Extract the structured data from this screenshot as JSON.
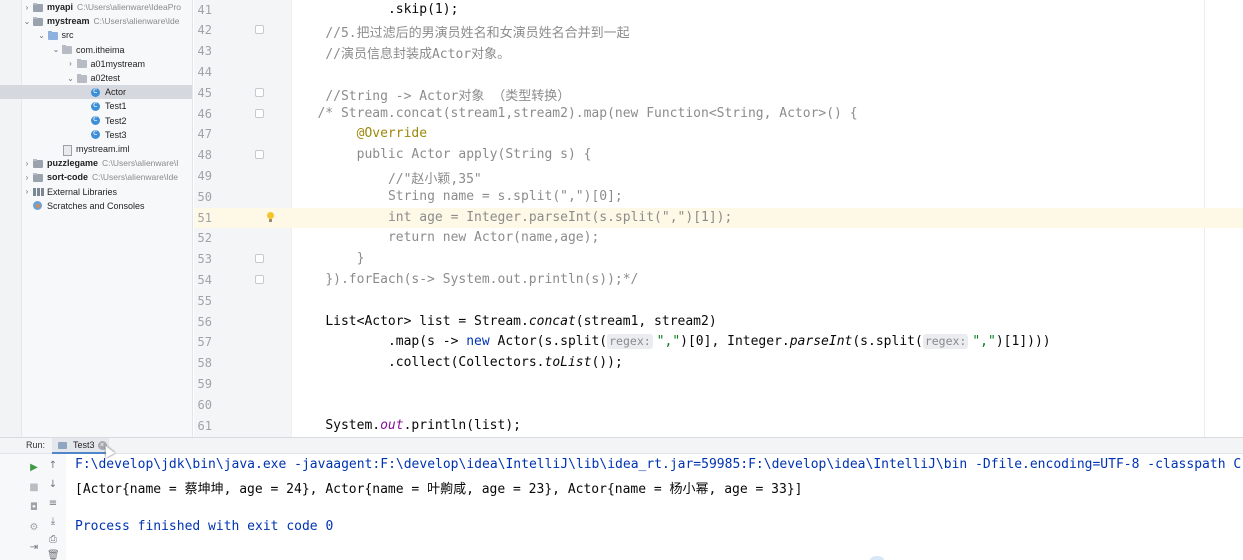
{
  "project_tree": {
    "items": [
      {
        "name": "myapi",
        "path": "C:\\Users\\alienware\\IdeaPro",
        "depth": 0,
        "arrow": "›",
        "icon": "module-folder-icon",
        "bold": true
      },
      {
        "name": "mystream",
        "path": "C:\\Users\\alienware\\Ide",
        "depth": 0,
        "arrow": "⌄",
        "icon": "module-folder-icon",
        "bold": true
      },
      {
        "name": "src",
        "path": "",
        "depth": 1,
        "arrow": "⌄",
        "icon": "source-folder-icon",
        "bold": false
      },
      {
        "name": "com.itheima",
        "path": "",
        "depth": 2,
        "arrow": "⌄",
        "icon": "package-icon",
        "bold": false
      },
      {
        "name": "a01mystream",
        "path": "",
        "depth": 3,
        "arrow": "›",
        "icon": "package-icon",
        "bold": false
      },
      {
        "name": "a02test",
        "path": "",
        "depth": 3,
        "arrow": "⌄",
        "icon": "package-icon",
        "bold": false
      },
      {
        "name": "Actor",
        "path": "",
        "depth": 4,
        "arrow": "",
        "icon": "java-class-icon",
        "bold": false,
        "selected": true
      },
      {
        "name": "Test1",
        "path": "",
        "depth": 4,
        "arrow": "",
        "icon": "java-class-icon",
        "bold": false
      },
      {
        "name": "Test2",
        "path": "",
        "depth": 4,
        "arrow": "",
        "icon": "java-class-icon",
        "bold": false
      },
      {
        "name": "Test3",
        "path": "",
        "depth": 4,
        "arrow": "",
        "icon": "java-class-icon",
        "bold": false
      },
      {
        "name": "mystream.iml",
        "path": "",
        "depth": 2,
        "arrow": "",
        "icon": "iml-file-icon",
        "bold": false
      },
      {
        "name": "puzzlegame",
        "path": "C:\\Users\\alienware\\I",
        "depth": 0,
        "arrow": "›",
        "icon": "module-folder-icon",
        "bold": true
      },
      {
        "name": "sort-code",
        "path": "C:\\Users\\alienware\\Ide",
        "depth": 0,
        "arrow": "›",
        "icon": "module-folder-icon",
        "bold": true
      },
      {
        "name": "External Libraries",
        "path": "",
        "depth": 0,
        "arrow": "›",
        "icon": "libraries-icon",
        "bold": false
      },
      {
        "name": "Scratches and Consoles",
        "path": "",
        "depth": 0,
        "arrow": "",
        "icon": "scratches-icon",
        "bold": false
      }
    ]
  },
  "editor": {
    "caret_line": 51,
    "lines": [
      {
        "num": "41",
        "indent": 12,
        "fold": false,
        "bulb": false,
        "tokens": [
          {
            "t": ".skip(1);",
            "c": ""
          }
        ]
      },
      {
        "num": "42",
        "indent": 4,
        "fold": true,
        "bulb": false,
        "tokens": [
          {
            "t": "//5.把过滤后的男演员姓名和女演员姓名合并到一起",
            "c": "cmt"
          }
        ]
      },
      {
        "num": "43",
        "indent": 4,
        "fold": false,
        "bulb": false,
        "tokens": [
          {
            "t": "//演员信息封装成Actor对象。",
            "c": "cmt"
          }
        ]
      },
      {
        "num": "44",
        "indent": 0,
        "fold": false,
        "bulb": false,
        "tokens": []
      },
      {
        "num": "45",
        "indent": 4,
        "fold": true,
        "bulb": false,
        "tokens": [
          {
            "t": "//String -> Actor对象 （类型转换）",
            "c": "cmt"
          }
        ]
      },
      {
        "num": "46",
        "indent": 3,
        "fold": true,
        "bulb": false,
        "tokens": [
          {
            "t": "/* Stream.concat(stream1,stream2).map(new Function<String, Actor>() {",
            "c": "cmt"
          }
        ]
      },
      {
        "num": "47",
        "indent": 8,
        "fold": false,
        "bulb": false,
        "tokens": [
          {
            "t": "@Override",
            "c": "ann"
          }
        ]
      },
      {
        "num": "48",
        "indent": 8,
        "fold": true,
        "bulb": false,
        "tokens": [
          {
            "t": "public Actor apply(String s) {",
            "c": "cmt"
          }
        ]
      },
      {
        "num": "49",
        "indent": 12,
        "fold": false,
        "bulb": false,
        "tokens": [
          {
            "t": "//\"赵小颖,35\"",
            "c": "cmt"
          }
        ]
      },
      {
        "num": "50",
        "indent": 12,
        "fold": false,
        "bulb": false,
        "tokens": [
          {
            "t": "String name = s.split(\",\")[0];",
            "c": "cmt"
          }
        ]
      },
      {
        "num": "51",
        "indent": 12,
        "fold": false,
        "bulb": true,
        "tokens": [
          {
            "t": "int age = Integer.parseInt(s.split(\",\")[1]);",
            "c": "cmt"
          }
        ]
      },
      {
        "num": "52",
        "indent": 12,
        "fold": false,
        "bulb": false,
        "tokens": [
          {
            "t": "return new Actor(name,age);",
            "c": "cmt"
          }
        ]
      },
      {
        "num": "53",
        "indent": 8,
        "fold": true,
        "bulb": false,
        "tokens": [
          {
            "t": "}",
            "c": "cmt"
          }
        ]
      },
      {
        "num": "54",
        "indent": 4,
        "fold": true,
        "bulb": false,
        "tokens": [
          {
            "t": "}).forEach(s-> System.out.println(s));*/",
            "c": "cmt"
          }
        ]
      },
      {
        "num": "55",
        "indent": 0,
        "fold": false,
        "bulb": false,
        "tokens": []
      },
      {
        "num": "56",
        "indent": 4,
        "fold": false,
        "bulb": false,
        "tokens": [
          {
            "t": "List<Actor> list = Stream.",
            "c": ""
          },
          {
            "t": "concat",
            "c": "ital"
          },
          {
            "t": "(stream1, stream2)",
            "c": ""
          }
        ]
      },
      {
        "num": "57",
        "indent": 12,
        "fold": false,
        "bulb": false,
        "tokens": [
          {
            "t": ".map(s -> ",
            "c": ""
          },
          {
            "t": "new",
            "c": "kw"
          },
          {
            "t": " Actor(s.split(",
            "c": ""
          },
          {
            "t": "regex:",
            "c": "hint"
          },
          {
            "t": "\",\"",
            "c": "str"
          },
          {
            "t": ")[0], Integer.",
            "c": ""
          },
          {
            "t": "parseInt",
            "c": "ital"
          },
          {
            "t": "(s.split(",
            "c": ""
          },
          {
            "t": "regex:",
            "c": "hint"
          },
          {
            "t": "\",\"",
            "c": "str"
          },
          {
            "t": ")[1])))",
            "c": ""
          }
        ]
      },
      {
        "num": "58",
        "indent": 12,
        "fold": false,
        "bulb": false,
        "tokens": [
          {
            "t": ".collect(Collectors.",
            "c": ""
          },
          {
            "t": "toList",
            "c": "ital"
          },
          {
            "t": "());",
            "c": ""
          }
        ]
      },
      {
        "num": "59",
        "indent": 0,
        "fold": false,
        "bulb": false,
        "tokens": []
      },
      {
        "num": "60",
        "indent": 0,
        "fold": false,
        "bulb": false,
        "tokens": []
      },
      {
        "num": "61",
        "indent": 4,
        "fold": false,
        "bulb": false,
        "tokens": [
          {
            "t": "System.",
            "c": ""
          },
          {
            "t": "out",
            "c": "fld"
          },
          {
            "t": ".println(list);",
            "c": ""
          }
        ]
      }
    ]
  },
  "run_panel": {
    "title": "Run:",
    "tab_label": "Test3",
    "console_lines": [
      {
        "text": "F:\\develop\\jdk\\bin\\java.exe -javaagent:F:\\develop\\idea\\IntelliJ\\lib\\idea_rt.jar=59985:F:\\develop\\idea\\IntelliJ\\bin -Dfile.encoding=UTF-8 -classpath C",
        "kind": "cmd"
      },
      {
        "text": "[Actor{name = 蔡坤坤, age = 24}, Actor{name = 叶齁咸, age = 23}, Actor{name = 杨小幂, age = 33}]",
        "kind": "out"
      },
      {
        "text": "",
        "kind": "out"
      },
      {
        "text": "Process finished with exit code 0",
        "kind": "exit"
      }
    ],
    "toolbar": [
      {
        "name": "rerun-icon",
        "glyph": "▶",
        "color": "#3f9a43"
      },
      {
        "name": "stop-icon",
        "glyph": "■",
        "color": "#b9bcc0"
      },
      {
        "name": "camera-icon",
        "glyph": "◘",
        "color": "#9ea3a8"
      },
      {
        "name": "settings-icon",
        "glyph": "⚙",
        "color": "#9ea3a8"
      },
      {
        "name": "login-icon",
        "glyph": "⇥",
        "color": "#6e7378"
      },
      {
        "name": "scroll-up-icon",
        "glyph": "↑",
        "color": "#6e7378"
      },
      {
        "name": "scroll-down-icon",
        "glyph": "↓",
        "color": "#6e7378"
      },
      {
        "name": "soft-wrap-icon",
        "glyph": "≡",
        "color": "#6e7378"
      },
      {
        "name": "scroll-to-end-icon",
        "glyph": "⤓",
        "color": "#6e7378"
      },
      {
        "name": "print-icon",
        "glyph": "⎙",
        "color": "#6e7378"
      },
      {
        "name": "trash-icon",
        "glyph": "🗑",
        "color": "#6e7378"
      }
    ]
  }
}
